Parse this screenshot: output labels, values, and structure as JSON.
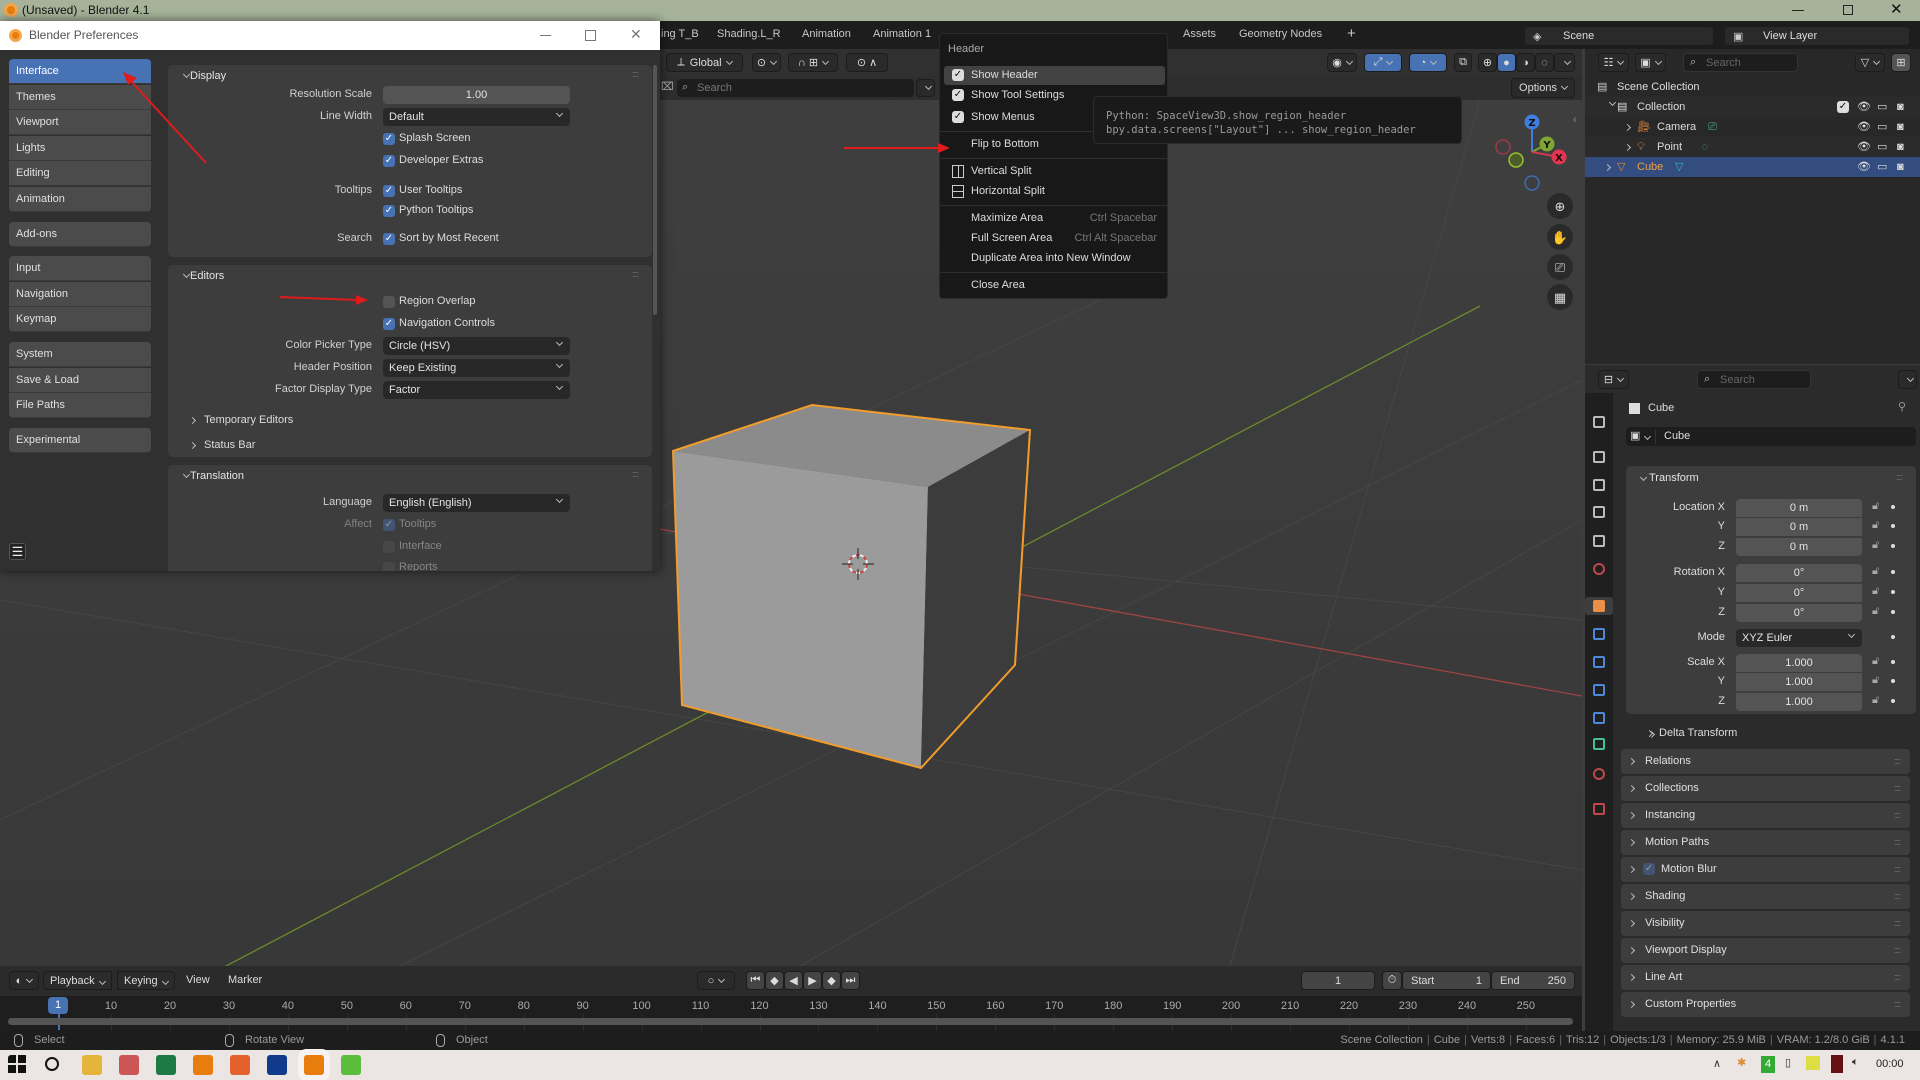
{
  "window_title": "(Unsaved) - Blender 4.1",
  "workspace_tabs": [
    "ing T_B",
    "Shading.L_R",
    "Animation",
    "Animation 1",
    "Assets",
    "Geometry Nodes",
    "+"
  ],
  "scene": "Scene",
  "view_layer": "View Layer",
  "viewport_header": {
    "orientation": "Global",
    "search_placeholder": "Search",
    "options_label": "Options"
  },
  "preferences": {
    "title": "Blender Preferences",
    "active": "Interface",
    "nav_groups": [
      [
        "Interface",
        "Themes",
        "Viewport",
        "Lights",
        "Editing",
        "Animation"
      ],
      [
        "Add-ons"
      ],
      [
        "Input",
        "Navigation",
        "Keymap"
      ],
      [
        "System",
        "Save & Load",
        "File Paths"
      ],
      [
        "Experimental"
      ]
    ],
    "sections": [
      {
        "title": "Display",
        "rows": [
          {
            "label": "Resolution Scale",
            "kind": "number",
            "value": "1.00"
          },
          {
            "label": "Line Width",
            "kind": "select",
            "value": "Default"
          },
          {
            "kind": "check",
            "value": "Splash Screen",
            "checked": true
          },
          {
            "kind": "check",
            "value": "Developer Extras",
            "checked": true
          },
          {
            "label": "Tooltips",
            "kind": "check",
            "value": "User Tooltips",
            "checked": true
          },
          {
            "kind": "check",
            "value": "Python Tooltips",
            "checked": true
          },
          {
            "label": "Search",
            "kind": "check",
            "value": "Sort by Most Recent",
            "checked": true
          }
        ]
      },
      {
        "title": "Editors",
        "rows": [
          {
            "kind": "check",
            "value": "Region Overlap",
            "checked": false
          },
          {
            "kind": "check",
            "value": "Navigation Controls",
            "checked": true
          },
          {
            "label": "Color Picker Type",
            "kind": "select",
            "value": "Circle (HSV)"
          },
          {
            "label": "Header Position",
            "kind": "select",
            "value": "Keep Existing"
          },
          {
            "label": "Factor Display Type",
            "kind": "select",
            "value": "Factor"
          }
        ],
        "subpanels": [
          "Temporary Editors",
          "Status Bar"
        ]
      },
      {
        "title": "Translation",
        "rows": [
          {
            "label": "Language",
            "kind": "select",
            "value": "English (English)"
          },
          {
            "label": "Affect",
            "kind": "check",
            "value": "Tooltips",
            "checked": true,
            "disabled": true
          },
          {
            "kind": "check",
            "value": "Interface",
            "checked": false,
            "disabled": true
          },
          {
            "kind": "check",
            "value": "Reports",
            "checked": false,
            "disabled": true
          }
        ]
      }
    ]
  },
  "header_menu": {
    "title": "Header",
    "items": [
      {
        "label": "Show Header",
        "checked": true,
        "highlighted": true
      },
      {
        "label": "Show Tool Settings",
        "checked": true
      },
      {
        "label": "Show Menus",
        "checked": true
      },
      {
        "separator": true
      },
      {
        "label": "Flip to Bottom"
      },
      {
        "separator": true
      },
      {
        "label": "Vertical Split",
        "icon": "vertical-split"
      },
      {
        "label": "Horizontal Split",
        "icon": "horizontal-split"
      },
      {
        "separator": true
      },
      {
        "label": "Maximize Area",
        "shortcut": "Ctrl Spacebar"
      },
      {
        "label": "Full Screen Area",
        "shortcut": "Ctrl Alt Spacebar"
      },
      {
        "label": "Duplicate Area into New Window"
      },
      {
        "separator": true
      },
      {
        "label": "Close Area"
      }
    ]
  },
  "tooltip": {
    "line1": "Python: SpaceView3D.show_region_header",
    "line2": "bpy.data.screens[\"Layout\"] ... show_region_header"
  },
  "gizmo": {
    "z": "Z",
    "y": "Y",
    "x": "X"
  },
  "outliner": {
    "search_placeholder": "Search",
    "rows": [
      {
        "label": "Scene Collection",
        "icon": "scene-collection",
        "depth": 0
      },
      {
        "label": "Collection",
        "icon": "collection",
        "depth": 1,
        "expanded": true,
        "checked": true
      },
      {
        "label": "Camera",
        "icon": "camera-object",
        "depth": 2,
        "data_icon": "camera-data"
      },
      {
        "label": "Point",
        "icon": "light-object",
        "depth": 2,
        "data_icon": "light-data"
      },
      {
        "label": "Cube",
        "icon": "mesh-object",
        "depth": 1,
        "data_icon": "mesh-data",
        "selected": true
      }
    ]
  },
  "properties": {
    "search_placeholder": "Search",
    "context": "Cube",
    "object_name": "Cube",
    "transform_title": "Transform",
    "fields": [
      {
        "label": "Location X",
        "value": "0 m"
      },
      {
        "label": "Y",
        "value": "0 m"
      },
      {
        "label": "Z",
        "value": "0 m"
      },
      {
        "label": "Rotation X",
        "value": "0°"
      },
      {
        "label": "Y",
        "value": "0°"
      },
      {
        "label": "Z",
        "value": "0°"
      },
      {
        "label": "Mode",
        "value": "XYZ Euler",
        "kind": "select"
      },
      {
        "label": "Scale X",
        "value": "1.000"
      },
      {
        "label": "Y",
        "value": "1.000"
      },
      {
        "label": "Z",
        "value": "1.000"
      }
    ],
    "delta_transform": "Delta Transform",
    "panels": [
      "Relations",
      "Collections",
      "Instancing",
      "Motion Paths",
      "Motion Blur",
      "Shading",
      "Visibility",
      "Viewport Display",
      "Line Art",
      "Custom Properties"
    ],
    "motion_blur_checked": true,
    "active_tab": "object"
  },
  "timeline": {
    "menus": [
      "Playback",
      "Keying",
      "View",
      "Marker"
    ],
    "current_frame": "1",
    "start_label": "Start",
    "start": "1",
    "end_label": "End",
    "end": "250",
    "ruler": [
      "1",
      "10",
      "20",
      "30",
      "40",
      "50",
      "60",
      "70",
      "80",
      "90",
      "100",
      "110",
      "120",
      "130",
      "140",
      "150",
      "160",
      "170",
      "180",
      "190",
      "200",
      "210",
      "220",
      "230",
      "240",
      "250"
    ]
  },
  "statusbar": {
    "hints": [
      "Select",
      "Rotate View",
      "Object"
    ],
    "stats": [
      "Scene Collection",
      "Cube",
      "Verts:8",
      "Faces:6",
      "Tris:12",
      "Objects:1/3",
      "Memory: 25.9 MiB",
      "VRAM: 1.2/8.0 GiB",
      "4.1.1"
    ]
  },
  "taskbar": {
    "apps": [
      "windows-start",
      "search",
      "file-explorer",
      "paint",
      "excel",
      "blender",
      "firefox",
      "terminal-app",
      "blender-active",
      "spreadsheet-app"
    ],
    "tray_badge": "4",
    "clock": "00:00"
  },
  "colors": {
    "accent": "#4772b3",
    "selection": "#f29d2b",
    "x_axis": "#c93b4f",
    "y_axis": "#7fa632",
    "z_axis": "#3d7ee0"
  }
}
